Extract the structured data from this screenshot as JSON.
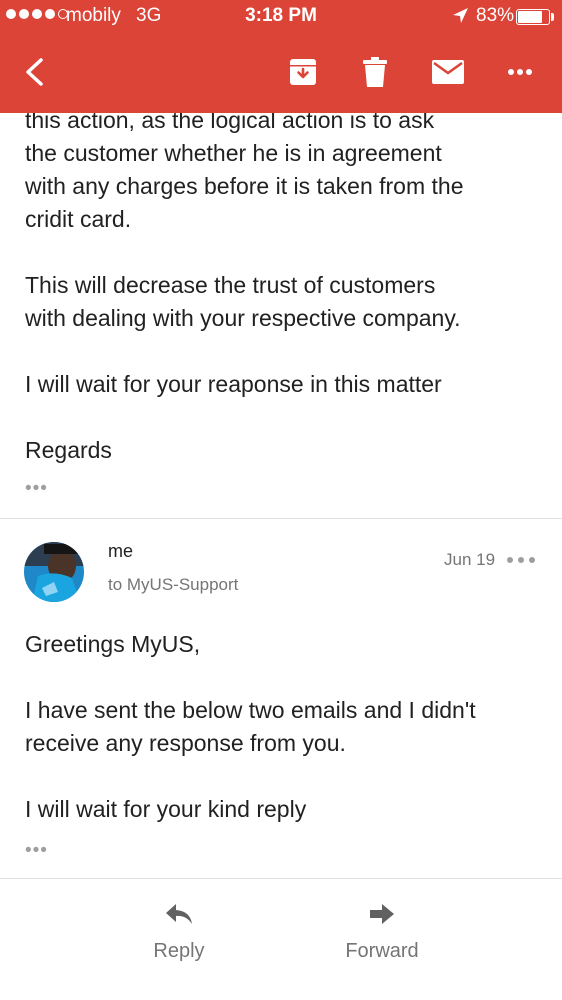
{
  "status_bar": {
    "carrier": "mobily",
    "network": "3G",
    "time": "3:18 PM",
    "battery_percent": "83%",
    "battery_level": 0.83
  },
  "toolbar": {
    "back_icon": "back-arrow-icon",
    "archive_icon": "archive-icon",
    "delete_icon": "trash-icon",
    "mark_unread_icon": "mail-icon",
    "more_icon": "more-icon"
  },
  "previous_message": {
    "lines": [
      "this action, as the logical action is to ask",
      "the customer whether he is in agreement",
      "with any charges before it is taken from the",
      "cridit card.",
      "This will decrease the trust of customers",
      "with dealing with your respective company.",
      "I will wait for your reaponse in this matter",
      "Regards"
    ],
    "trimmed_indicator": "•••"
  },
  "message": {
    "sender": "me",
    "recipient": "to MyUS-Support",
    "date": "Jun 19",
    "body_lines": [
      "Greetings MyUS,",
      "I have sent the below two emails and I didn't",
      "receive any response from you.",
      "I will wait for your kind reply"
    ],
    "trimmed_indicator": "•••"
  },
  "actions": {
    "reply_label": "Reply",
    "forward_label": "Forward"
  },
  "colors": {
    "header": "#db4437",
    "text": "#212121",
    "secondary_text": "#757575"
  }
}
